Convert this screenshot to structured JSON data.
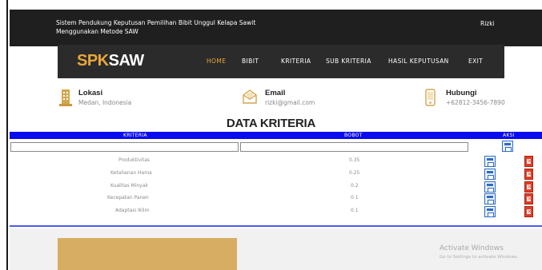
{
  "header": {
    "site_title": "Sistem Pendukung Keputusan Pemilihan Bibit Unggul Kelapa Sawit Menggunakan Metode SAW",
    "user_name": "Rizki"
  },
  "brand": {
    "part1": "SPK",
    "part2": "SAW"
  },
  "nav": {
    "home": "HOME",
    "bibit": "BIBIT",
    "kriteria": "KRITERIA",
    "sub_kriteria": "SUB KRITERIA",
    "hasil_keputusan": "HASIL KEPUTUSAN",
    "exit": "EXIT"
  },
  "info": {
    "lokasi": {
      "title": "Lokasi",
      "value": "Medan, Indonesia",
      "icon": "building-icon"
    },
    "email": {
      "title": "Email",
      "value": "rizki@gmail.com",
      "icon": "mail-icon"
    },
    "hubungi": {
      "title": "Hubungi",
      "value": "+62812-3456-7890",
      "icon": "phone-icon"
    }
  },
  "page_title": "DATA KRITERIA",
  "table": {
    "headers": {
      "kriteria": "KRITERIA",
      "bobot": "BOBOT",
      "aksi": "AKSI"
    },
    "rows": [
      {
        "kriteria": "Produktivitas",
        "bobot": "0.35"
      },
      {
        "kriteria": "Ketahanan Hama",
        "bobot": "0.25"
      },
      {
        "kriteria": "Kualitas Minyak",
        "bobot": "0.2"
      },
      {
        "kriteria": "Kecepatan Panen",
        "bobot": "0.1"
      },
      {
        "kriteria": "Adaptasi Iklim",
        "bobot": "0.1"
      }
    ]
  },
  "windows_notice": {
    "title": "Activate Windows",
    "subtitle": "Go to Settings to activate Windows."
  },
  "colors": {
    "topbar": "#1f1f1f",
    "navbar": "#2b2b2b",
    "accent_gold": "#e8a838",
    "table_header": "#0b0bf0",
    "delete_red": "#e23d28",
    "save_blue": "#2c6cc4"
  }
}
